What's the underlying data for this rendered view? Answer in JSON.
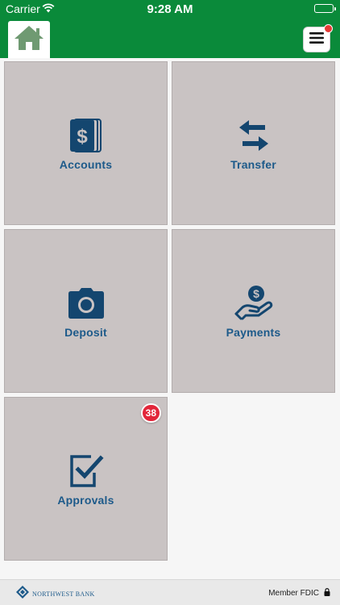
{
  "status_bar": {
    "carrier": "Carrier",
    "time": "9:28 AM"
  },
  "header": {
    "home_icon": "home-icon",
    "menu_icon": "hamburger-menu-icon",
    "menu_has_notification": true
  },
  "tiles": [
    {
      "label": "Accounts",
      "icon": "accounts-dollar-cards-icon"
    },
    {
      "label": "Transfer",
      "icon": "transfer-arrows-icon"
    },
    {
      "label": "Deposit",
      "icon": "camera-icon"
    },
    {
      "label": "Payments",
      "icon": "hand-dollar-icon"
    },
    {
      "label": "Approvals",
      "icon": "checkbox-approval-icon",
      "badge": "38"
    }
  ],
  "footer": {
    "bank_name": "NORTHWEST BANK",
    "fdic": "Member FDIC"
  },
  "colors": {
    "header_green": "#0a8a3a",
    "tile_bg": "#c9c3c3",
    "label_blue": "#1d5a8a",
    "icon_blue": "#14466f",
    "badge_red": "#e2263a"
  }
}
